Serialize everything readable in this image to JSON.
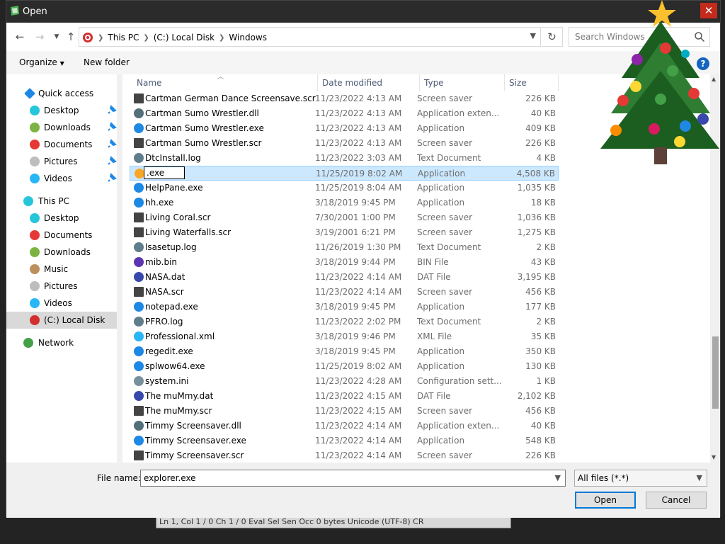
{
  "window": {
    "title": "Open",
    "close_glyph": "✕"
  },
  "nav": {
    "back_icon": "arrow-left-icon",
    "forward_icon": "arrow-right-icon",
    "recent_icon": "chevron-down-icon",
    "up_icon": "arrow-up-icon",
    "breadcrumb": [
      "This PC",
      "(C:) Local Disk",
      "Windows"
    ],
    "search_placeholder": "Search Windows"
  },
  "toolbar": {
    "organize_label": "Organize",
    "new_folder_label": "New folder"
  },
  "navpane": {
    "quick_access": "Quick access",
    "quick_items": [
      "Desktop",
      "Downloads",
      "Documents",
      "Pictures",
      "Videos"
    ],
    "this_pc": "This PC",
    "pc_items": [
      "Desktop",
      "Documents",
      "Downloads",
      "Music",
      "Pictures",
      "Videos",
      "(C:) Local Disk"
    ],
    "network": "Network"
  },
  "columns": {
    "name": "Name",
    "date": "Date modified",
    "type": "Type",
    "size": "Size"
  },
  "files": [
    {
      "name": "Cartman German Dance Screensave.scr",
      "date": "11/23/2022 4:13 AM",
      "type": "Screen saver",
      "size": "226 KB"
    },
    {
      "name": "Cartman Sumo Wrestler.dll",
      "date": "11/23/2022 4:13 AM",
      "type": "Application exten...",
      "size": "40 KB"
    },
    {
      "name": "Cartman Sumo Wrestler.exe",
      "date": "11/23/2022 4:13 AM",
      "type": "Application",
      "size": "409 KB"
    },
    {
      "name": "Cartman Sumo Wrestler.scr",
      "date": "11/23/2022 4:13 AM",
      "type": "Screen saver",
      "size": "226 KB"
    },
    {
      "name": "DtcInstall.log",
      "date": "11/23/2022 3:03 AM",
      "type": "Text Document",
      "size": "4 KB"
    },
    {
      "name": ".exe",
      "date": "11/25/2019 8:02 AM",
      "type": "Application",
      "size": "4,508 KB"
    },
    {
      "name": "HelpPane.exe",
      "date": "11/25/2019 8:04 AM",
      "type": "Application",
      "size": "1,035 KB"
    },
    {
      "name": "hh.exe",
      "date": "3/18/2019 9:45 PM",
      "type": "Application",
      "size": "18 KB"
    },
    {
      "name": "Living Coral.scr",
      "date": "7/30/2001 1:00 PM",
      "type": "Screen saver",
      "size": "1,036 KB"
    },
    {
      "name": "Living Waterfalls.scr",
      "date": "3/19/2001 6:21 PM",
      "type": "Screen saver",
      "size": "1,275 KB"
    },
    {
      "name": "lsasetup.log",
      "date": "11/26/2019 1:30 PM",
      "type": "Text Document",
      "size": "2 KB"
    },
    {
      "name": "mib.bin",
      "date": "3/18/2019 9:44 PM",
      "type": "BIN File",
      "size": "43 KB"
    },
    {
      "name": "NASA.dat",
      "date": "11/23/2022 4:14 AM",
      "type": "DAT File",
      "size": "3,195 KB"
    },
    {
      "name": "NASA.scr",
      "date": "11/23/2022 4:14 AM",
      "type": "Screen saver",
      "size": "456 KB"
    },
    {
      "name": "notepad.exe",
      "date": "3/18/2019 9:45 PM",
      "type": "Application",
      "size": "177 KB"
    },
    {
      "name": "PFRO.log",
      "date": "11/23/2022 2:02 PM",
      "type": "Text Document",
      "size": "2 KB"
    },
    {
      "name": "Professional.xml",
      "date": "3/18/2019 9:46 PM",
      "type": "XML File",
      "size": "35 KB"
    },
    {
      "name": "regedit.exe",
      "date": "3/18/2019 9:45 PM",
      "type": "Application",
      "size": "350 KB"
    },
    {
      "name": "splwow64.exe",
      "date": "11/25/2019 8:02 AM",
      "type": "Application",
      "size": "130 KB"
    },
    {
      "name": "system.ini",
      "date": "11/23/2022 4:28 AM",
      "type": "Configuration sett...",
      "size": "1 KB"
    },
    {
      "name": "The muMmy.dat",
      "date": "11/23/2022 4:15 AM",
      "type": "DAT File",
      "size": "2,102 KB"
    },
    {
      "name": "The muMmy.scr",
      "date": "11/23/2022 4:15 AM",
      "type": "Screen saver",
      "size": "456 KB"
    },
    {
      "name": "Timmy Screensaver.dll",
      "date": "11/23/2022 4:14 AM",
      "type": "Application exten...",
      "size": "40 KB"
    },
    {
      "name": "Timmy Screensaver.exe",
      "date": "11/23/2022 4:14 AM",
      "type": "Application",
      "size": "548 KB"
    },
    {
      "name": "Timmy Screensaver.scr",
      "date": "11/23/2022 4:14 AM",
      "type": "Screen saver",
      "size": "226 KB"
    }
  ],
  "rename_value": ".exe",
  "bottom": {
    "file_name_label": "File name:",
    "file_name_value": "explorer.exe",
    "filter_value": "All files (*.*)",
    "open_label": "Open",
    "cancel_label": "Cancel"
  },
  "statusbar_text": "Ln 1, Col 1 / 0   Ch 1 / 0   Eval   Sel   Sen   Occ   0 bytes   Unicode (UTF-8)   CR",
  "colors": {
    "accent": "#0078d7",
    "selection": "#cce8ff",
    "titlebar": "#2b2b2b",
    "close": "#c42b1c"
  }
}
